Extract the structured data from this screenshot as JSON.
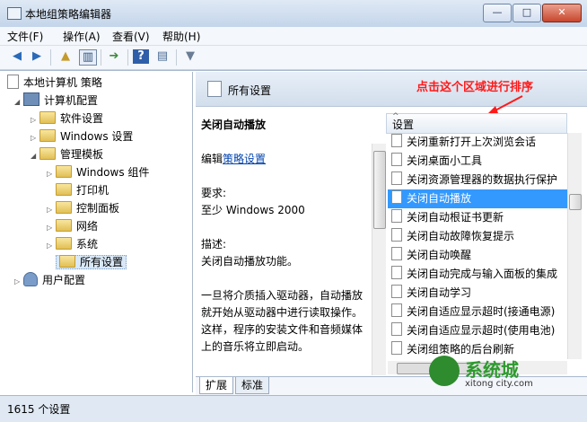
{
  "window": {
    "title": "本地组策略编辑器",
    "caption": {
      "min": "—",
      "max": "□",
      "close": "✕"
    }
  },
  "menu": [
    "文件(F)",
    "操作(A)",
    "查看(V)",
    "帮助(H)"
  ],
  "tree": {
    "root": "本地计算机 策略",
    "computer_config": "计算机配置",
    "software_settings": "软件设置",
    "windows_settings": "Windows 设置",
    "admin_templates": "管理模板",
    "windows_components": "Windows 组件",
    "printers": "打印机",
    "control_panel": "控制面板",
    "network": "网络",
    "system": "系统",
    "all_settings": "所有设置",
    "user_config": "用户配置"
  },
  "right_header": "所有设置",
  "annotation": "点击这个区域进行排序",
  "description": {
    "title": "关闭自动播放",
    "edit_prefix": "编辑",
    "edit_link": "策略设置",
    "requirements_label": "要求:",
    "requirements_value": "至少 Windows 2000",
    "desc_label": "描述:",
    "desc_text": "关闭自动播放功能。",
    "desc_more": "一旦将介质插入驱动器，自动播放就开始从驱动器中进行读取操作。这样，程序的安装文件和音频媒体上的音乐将立即启动。"
  },
  "list": {
    "header": "设置",
    "items": [
      "关闭重新打开上次浏览会话",
      "关闭桌面小工具",
      "关闭资源管理器的数据执行保护",
      "关闭自动播放",
      "关闭自动根证书更新",
      "关闭自动故障恢复提示",
      "关闭自动唤醒",
      "关闭自动完成与输入面板的集成",
      "关闭自动学习",
      "关闭自适应显示超时(接通电源)",
      "关闭自适应显示超时(使用电池)",
      "关闭组策略的后台刷新"
    ],
    "selected_index": 3
  },
  "tabs": [
    "扩展",
    "标准"
  ],
  "status": "1615 个设置",
  "watermark": {
    "text": "系统城",
    "url": "xitong city.com"
  }
}
